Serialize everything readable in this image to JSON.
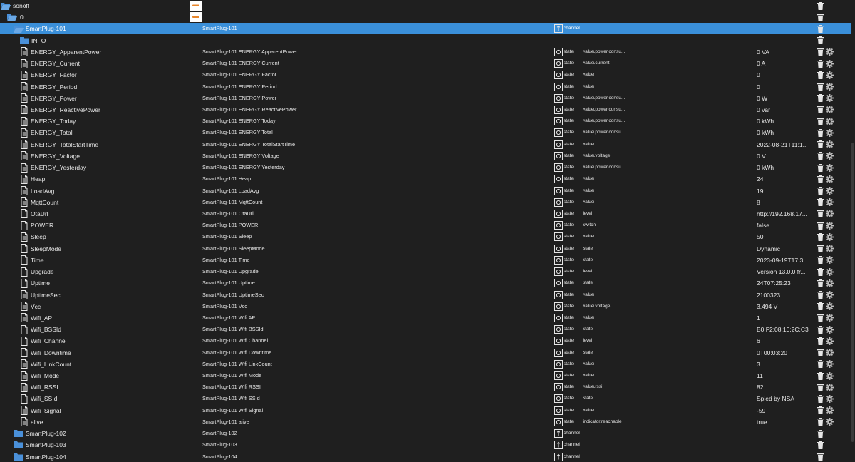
{
  "colors": {
    "background": "#1f1f1f",
    "selected_row": "#3a8fd9",
    "folder": "#4a90d9",
    "logo_orange": "#e8862b"
  },
  "tree": [
    {
      "kind": "folder",
      "open": true,
      "indent": 0,
      "name": "sonoff",
      "logo": true
    },
    {
      "kind": "folder",
      "open": true,
      "indent": 1,
      "name": "0",
      "logo": true
    },
    {
      "kind": "folder",
      "open": true,
      "indent": 2,
      "name": "SmartPlug-101",
      "desc": "SmartPlug-101",
      "type": "channel",
      "selected": true
    },
    {
      "kind": "folder",
      "open": false,
      "indent": 3,
      "name": "INFO"
    },
    {
      "kind": "state",
      "name": "ENERGY_ApparentPower",
      "desc": "SmartPlug-101 ENERGY ApparentPower",
      "type": "state",
      "role": "value.power.consu...",
      "value": "0 VA"
    },
    {
      "kind": "state",
      "name": "ENERGY_Current",
      "desc": "SmartPlug-101 ENERGY Current",
      "type": "state",
      "role": "value.current",
      "value": "0 A"
    },
    {
      "kind": "state",
      "name": "ENERGY_Factor",
      "desc": "SmartPlug-101 ENERGY Factor",
      "type": "state",
      "role": "value",
      "value": "0"
    },
    {
      "kind": "state",
      "name": "ENERGY_Period",
      "desc": "SmartPlug-101 ENERGY Period",
      "type": "state",
      "role": "value",
      "value": "0"
    },
    {
      "kind": "state",
      "name": "ENERGY_Power",
      "desc": "SmartPlug-101 ENERGY Power",
      "type": "state",
      "role": "value.power.consu...",
      "value": "0 W"
    },
    {
      "kind": "state",
      "name": "ENERGY_ReactivePower",
      "desc": "SmartPlug-101 ENERGY ReactivePower",
      "type": "state",
      "role": "value.power.consu...",
      "value": "0 var"
    },
    {
      "kind": "state",
      "name": "ENERGY_Today",
      "desc": "SmartPlug-101 ENERGY Today",
      "type": "state",
      "role": "value.power.consu...",
      "value": "0 kWh"
    },
    {
      "kind": "state",
      "name": "ENERGY_Total",
      "desc": "SmartPlug-101 ENERGY Total",
      "type": "state",
      "role": "value.power.consu...",
      "value": "0 kWh"
    },
    {
      "kind": "state",
      "name": "ENERGY_TotalStartTime",
      "desc": "SmartPlug-101 ENERGY TotalStartTime",
      "type": "state",
      "role": "value",
      "value": "2022-08-21T11:1..."
    },
    {
      "kind": "state",
      "name": "ENERGY_Voltage",
      "desc": "SmartPlug-101 ENERGY Voltage",
      "type": "state",
      "role": "value.voltage",
      "value": "0 V"
    },
    {
      "kind": "state",
      "name": "ENERGY_Yesterday",
      "desc": "SmartPlug-101 ENERGY Yesterday",
      "type": "state",
      "role": "value.power.consu...",
      "value": "0 kWh"
    },
    {
      "kind": "state",
      "name": "Heap",
      "desc": "SmartPlug-101 Heap",
      "type": "state",
      "role": "value",
      "value": "24"
    },
    {
      "kind": "state",
      "name": "LoadAvg",
      "desc": "SmartPlug-101 LoadAvg",
      "type": "state",
      "role": "value",
      "value": "19"
    },
    {
      "kind": "state",
      "name": "MqttCount",
      "desc": "SmartPlug-101 MqttCount",
      "type": "state",
      "role": "value",
      "value": "8"
    },
    {
      "kind": "state",
      "icon": "outline",
      "name": "OtaUrl",
      "desc": "SmartPlug-101 OtaUrl",
      "type": "state",
      "role": "level",
      "value": "http://192.168.17..."
    },
    {
      "kind": "state",
      "icon": "outline",
      "name": "POWER",
      "desc": "SmartPlug-101 POWER",
      "type": "state",
      "role": "switch",
      "value": "false"
    },
    {
      "kind": "state",
      "name": "Sleep",
      "desc": "SmartPlug-101 Sleep",
      "type": "state",
      "role": "value",
      "value": "50"
    },
    {
      "kind": "state",
      "icon": "outline",
      "name": "SleepMode",
      "desc": "SmartPlug-101 SleepMode",
      "type": "state",
      "role": "state",
      "value": "Dynamic"
    },
    {
      "kind": "state",
      "icon": "outline",
      "name": "Time",
      "desc": "SmartPlug-101 Time",
      "type": "state",
      "role": "state",
      "value": "2023-09-19T17:3..."
    },
    {
      "kind": "state",
      "icon": "outline",
      "name": "Upgrade",
      "desc": "SmartPlug-101 Upgrade",
      "type": "state",
      "role": "level",
      "value": "Version 13.0.0 fr..."
    },
    {
      "kind": "state",
      "icon": "outline",
      "name": "Uptime",
      "desc": "SmartPlug-101 Uptime",
      "type": "state",
      "role": "state",
      "value": "24T07:25:23"
    },
    {
      "kind": "state",
      "name": "UptimeSec",
      "desc": "SmartPlug-101 UptimeSec",
      "type": "state",
      "role": "value",
      "value": "2100323"
    },
    {
      "kind": "state",
      "name": "Vcc",
      "desc": "SmartPlug-101 Vcc",
      "type": "state",
      "role": "value.voltage",
      "value": "3.494 V"
    },
    {
      "kind": "state",
      "name": "Wifi_AP",
      "desc": "SmartPlug-101 Wifi AP",
      "type": "state",
      "role": "value",
      "value": "1"
    },
    {
      "kind": "state",
      "icon": "outline",
      "name": "Wifi_BSSId",
      "desc": "SmartPlug-101 Wifi BSSId",
      "type": "state",
      "role": "state",
      "value": "B0:F2:08:10:2C:C3"
    },
    {
      "kind": "state",
      "icon": "outline",
      "name": "Wifi_Channel",
      "desc": "SmartPlug-101 Wifi Channel",
      "type": "state",
      "role": "level",
      "value": "6"
    },
    {
      "kind": "state",
      "icon": "outline",
      "name": "Wifi_Downtime",
      "desc": "SmartPlug-101 Wifi Downtime",
      "type": "state",
      "role": "state",
      "value": "0T00:03:20"
    },
    {
      "kind": "state",
      "name": "Wifi_LinkCount",
      "desc": "SmartPlug-101 Wifi LinkCount",
      "type": "state",
      "role": "value",
      "value": "3"
    },
    {
      "kind": "state",
      "name": "Wifi_Mode",
      "desc": "SmartPlug-101 Wifi Mode",
      "type": "state",
      "role": "value",
      "value": "11"
    },
    {
      "kind": "state",
      "name": "Wifi_RSSI",
      "desc": "SmartPlug-101 Wifi RSSI",
      "type": "state",
      "role": "value.rssi",
      "value": "82"
    },
    {
      "kind": "state",
      "icon": "outline",
      "name": "Wifi_SSId",
      "desc": "SmartPlug-101 Wifi SSId",
      "type": "state",
      "role": "state",
      "value": "Spied by NSA"
    },
    {
      "kind": "state",
      "name": "Wifi_Signal",
      "desc": "SmartPlug-101 Wifi Signal",
      "type": "state",
      "role": "value",
      "value": "-59"
    },
    {
      "kind": "state",
      "name": "alive",
      "desc": "SmartPlug-101 alive",
      "type": "state",
      "role": "indicator.reachable",
      "value": "true"
    },
    {
      "kind": "folder",
      "open": false,
      "indent": 2,
      "name": "SmartPlug-102",
      "desc": "SmartPlug-102",
      "type": "channel"
    },
    {
      "kind": "folder",
      "open": false,
      "indent": 2,
      "name": "SmartPlug-103",
      "desc": "SmartPlug-103",
      "type": "channel"
    },
    {
      "kind": "folder",
      "open": false,
      "indent": 2,
      "name": "SmartPlug-104",
      "desc": "SmartPlug-104",
      "type": "channel"
    }
  ]
}
